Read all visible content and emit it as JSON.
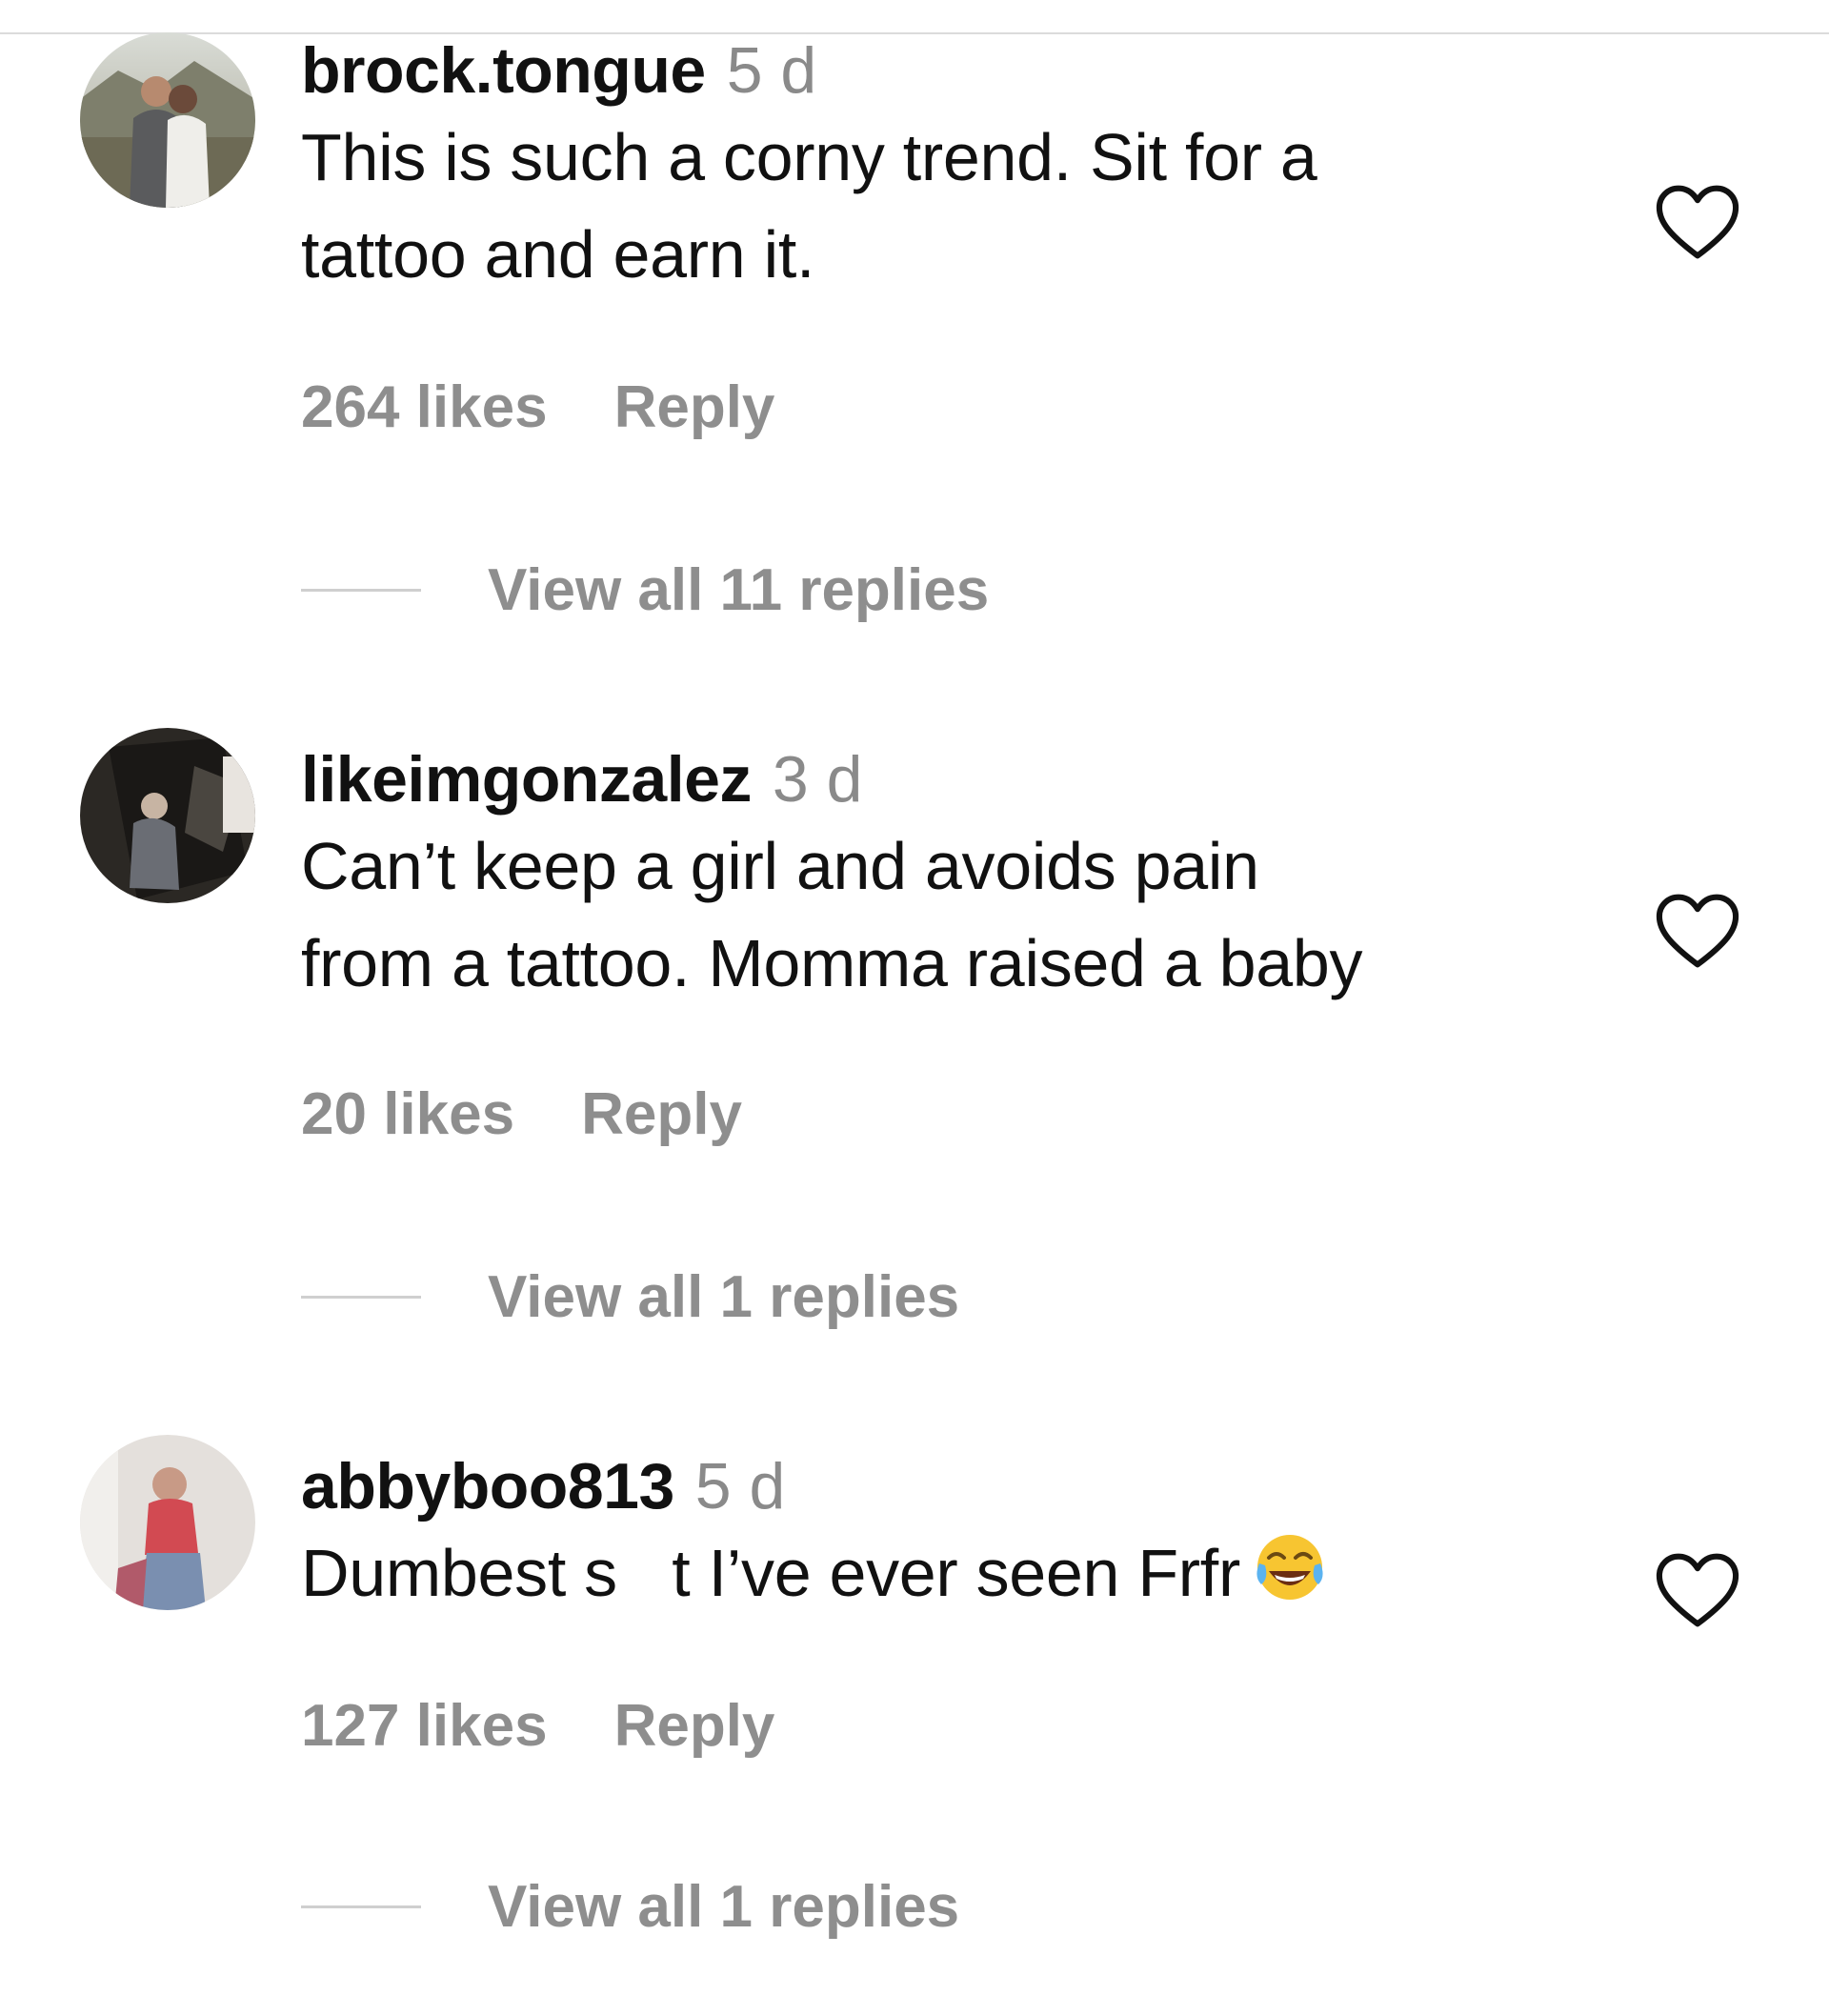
{
  "comments": [
    {
      "username": "brock.tongue",
      "time": "5 d",
      "text_lines": [
        "This is such a corny trend. Sit for a",
        "tattoo and earn it."
      ],
      "likes": "264 likes",
      "reply_label": "Reply",
      "view_replies": "View all 11 replies",
      "avatar_icon": "user-avatar-couple-photo"
    },
    {
      "username": "likeimgonzalez",
      "time": "3 d",
      "text_lines": [
        "Can’t keep a girl and avoids pain",
        "from a tattoo. Momma raised a baby"
      ],
      "likes": "20 likes",
      "reply_label": "Reply",
      "view_replies": "View all 1 replies",
      "avatar_icon": "user-avatar-dark-photo"
    },
    {
      "username": "abbyboo813",
      "time": "5 d",
      "text_lines": [
        "Dumbest s   t I’ve ever seen Frfr"
      ],
      "text_emoji": "face-with-tears-of-joy-emoji",
      "likes": "127 likes",
      "reply_label": "Reply",
      "view_replies": "View all 1 replies",
      "avatar_icon": "user-avatar-girl-photo"
    }
  ],
  "icons": {
    "like": "heart-outline-icon"
  },
  "colors": {
    "text": "#111111",
    "muted": "#8e8e8e",
    "divider": "#dbdbdb"
  }
}
